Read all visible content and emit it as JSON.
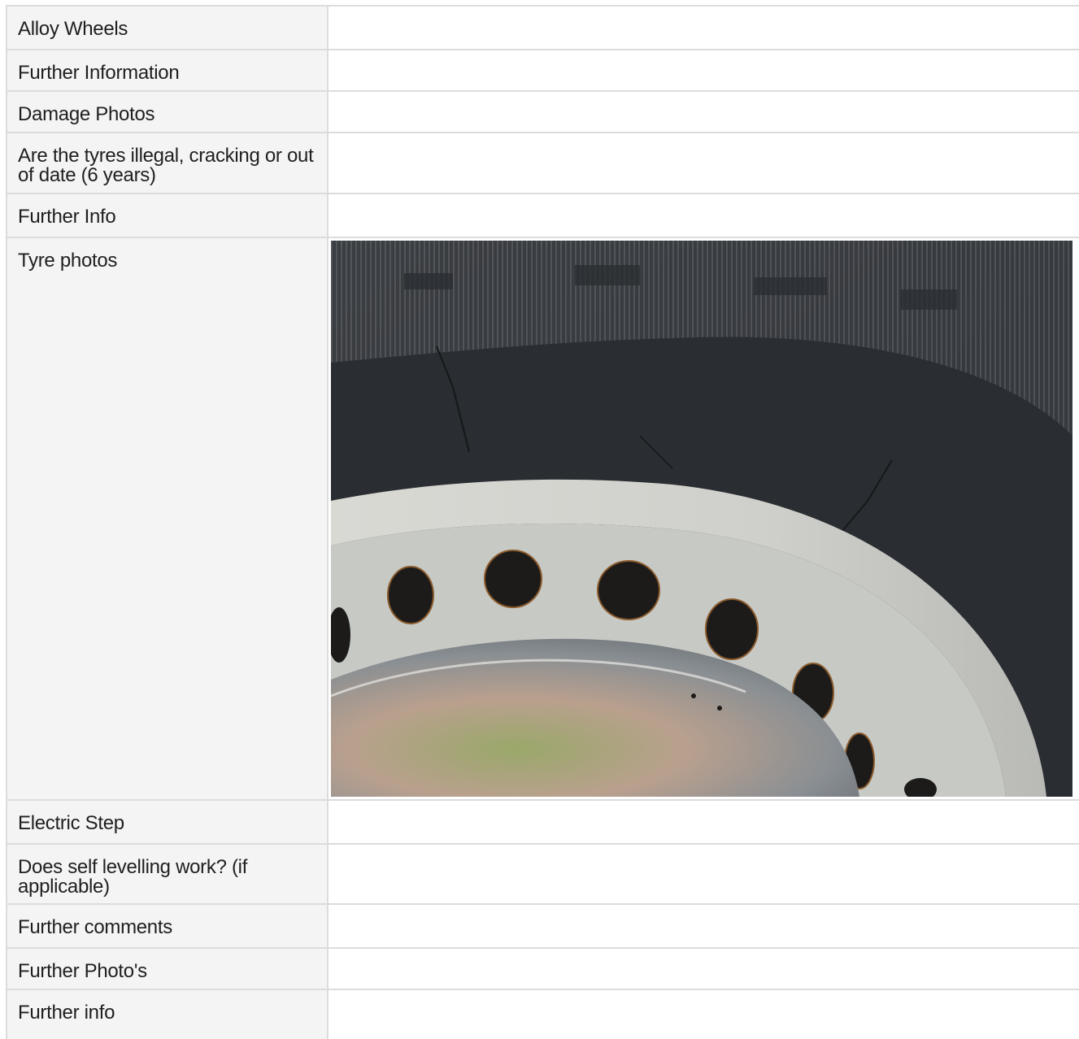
{
  "rows": [
    {
      "label": "Alloy Wheels",
      "value": ""
    },
    {
      "label": "Further Information",
      "value": ""
    },
    {
      "label": "Damage Photos",
      "value": ""
    },
    {
      "label": "Are the tyres illegal, cracking or out of date (6 years)",
      "value": ""
    },
    {
      "label": "Further Info",
      "value": ""
    },
    {
      "label": "Tyre photos",
      "image": "tyre-sidewall-photo"
    },
    {
      "label": "Electric Step",
      "value": ""
    },
    {
      "label": "Does self levelling work? (if applicable)",
      "value": ""
    },
    {
      "label": "Further comments",
      "value": ""
    },
    {
      "label": "Further Photo's",
      "value": ""
    },
    {
      "label": "Further info",
      "value": ""
    }
  ]
}
